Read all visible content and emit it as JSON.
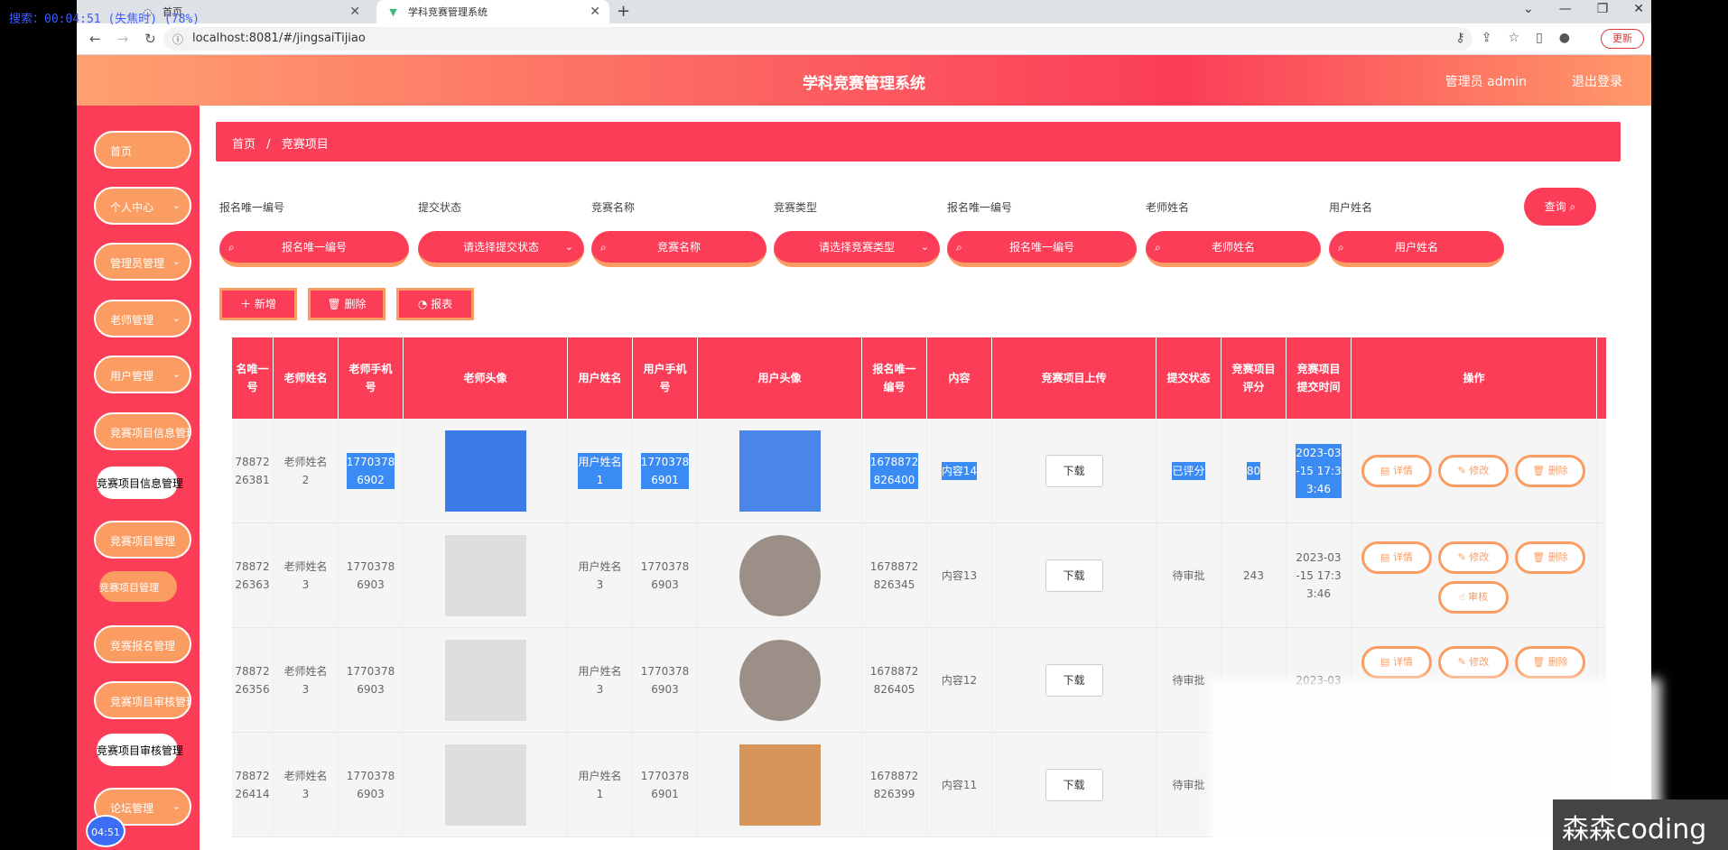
{
  "overlay": {
    "text": "搜索：00:04:51 (失焦时) (78%)"
  },
  "browser": {
    "tab1": "首页",
    "tab2": "学科竞赛管理系统",
    "url": "localhost:8081/#/jingsaiTijiao",
    "update": "更新"
  },
  "header": {
    "title": "学科竞赛管理系统",
    "admin": "管理员 admin",
    "logout": "退出登录"
  },
  "sidebar": {
    "items": [
      "首页",
      "个人中心",
      "管理员管理",
      "老师管理",
      "用户管理",
      "竞赛项目信息管理",
      "竞赛项目管理",
      "竞赛报名管理",
      "竞赛项目审核管理",
      "论坛管理"
    ],
    "subs": [
      "竞赛项目信息管理",
      "竞赛项目管理",
      "竞赛项目审核管理"
    ],
    "clock": "04:51"
  },
  "breadcrumb": {
    "home": "首页",
    "sep": "/",
    "current": "竞赛项目"
  },
  "filters": [
    {
      "label": "报名唯一编号",
      "placeholder": "报名唯一编号"
    },
    {
      "label": "提交状态",
      "placeholder": "请选择提交状态"
    },
    {
      "label": "竞赛名称",
      "placeholder": "竞赛名称"
    },
    {
      "label": "竞赛类型",
      "placeholder": "请选择竞赛类型"
    },
    {
      "label": "报名唯一编号",
      "placeholder": "报名唯一编号"
    },
    {
      "label": "老师姓名",
      "placeholder": "老师姓名"
    },
    {
      "label": "用户姓名",
      "placeholder": "用户姓名"
    }
  ],
  "query": "查询",
  "actions": {
    "add": "＋ 新增",
    "delete": "删除",
    "report": "报表"
  },
  "columns": [
    "名唯一\n号",
    "老师姓名",
    "老师手机\n号",
    "老师头像",
    "用户姓名",
    "用户手机\n号",
    "用户头像",
    "报名唯一\n编号",
    "内容",
    "竞赛项目上传",
    "提交状态",
    "竞赛项目\n评分",
    "竞赛项目\n提交时间",
    "操作"
  ],
  "rows": [
    {
      "no": "78872\n26381",
      "teacher": "老师姓名\n2",
      "tphone": "1770378\n6902",
      "user": "用户姓名\n1",
      "uphone": "1770378\n6901",
      "bno": "1678872\n826400",
      "content": "内容14",
      "download": "下载",
      "status": "已评分",
      "score": "80",
      "time": "2023-03\n-15 17:3\n3:46"
    },
    {
      "no": "78872\n26363",
      "teacher": "老师姓名\n3",
      "tphone": "1770378\n6903",
      "user": "用户姓名\n3",
      "uphone": "1770378\n6903",
      "bno": "1678872\n826345",
      "content": "内容13",
      "download": "下载",
      "status": "待审批",
      "score": "243",
      "time": "2023-03\n-15 17:3\n3:46"
    },
    {
      "no": "78872\n26356",
      "teacher": "老师姓名\n3",
      "tphone": "1770378\n6903",
      "user": "用户姓名\n3",
      "uphone": "1770378\n6903",
      "bno": "1678872\n826405",
      "content": "内容12",
      "download": "下载",
      "status": "待审批",
      "score": "",
      "time": "2023-03"
    },
    {
      "no": "78872\n26414",
      "teacher": "老师姓名\n3",
      "tphone": "1770378\n6903",
      "user": "用户姓名\n1",
      "uphone": "1770378\n6901",
      "bno": "1678872\n826399",
      "content": "内容11",
      "download": "下载",
      "status": "待审批",
      "score": "",
      "time": ""
    }
  ],
  "ops": {
    "detail": "详情",
    "edit": "修改",
    "del": "删除",
    "review": "审核"
  },
  "watermark": "森森coding"
}
